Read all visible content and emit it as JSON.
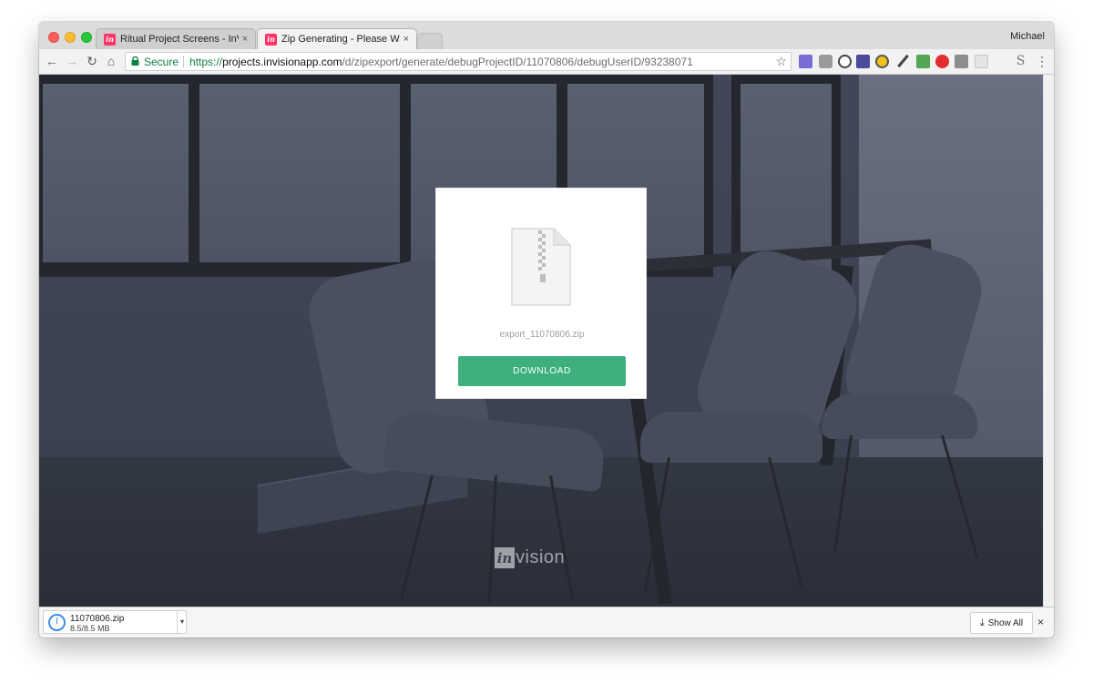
{
  "browser": {
    "profile_name": "Michael",
    "tabs": [
      {
        "title": "Ritual Project Screens - InVision",
        "close": "×",
        "active": false
      },
      {
        "title": "Zip Generating - Please Wait...",
        "close": "×",
        "active": true
      }
    ],
    "favicon_glyph": "in",
    "secure_label": "Secure",
    "url": {
      "scheme": "https://",
      "host": "projects.invisionapp.com",
      "path": "/d/zipexport/generate/debugProjectID/11070806/debugUserID/93238071"
    },
    "nav_icons": {
      "back": "←",
      "forward": "→",
      "reload": "↻",
      "home": "⌂",
      "star": "☆",
      "menu": "⋮"
    },
    "extension_icons": [
      "calendar-icon",
      "tools-icon",
      "onepassword-icon",
      "mail-icon",
      "chrome-icon",
      "pen-icon",
      "evernote-icon",
      "adblock-icon",
      "shield-icon",
      "reader-icon",
      "ghost-icon",
      "s-icon"
    ],
    "extension_12_glyph": "S"
  },
  "page": {
    "file_name": "export_11070806.zip",
    "download_button": "DOWNLOAD",
    "logo": {
      "badge": "in",
      "wordmark": "vision"
    }
  },
  "download_shelf": {
    "file_name": "11070806.zip",
    "progress": "8.5/8.5 MB",
    "progress_fraction": 1.0,
    "show_all": "Show All",
    "show_all_icon": "⤓",
    "dropdown_glyph": "▾",
    "close": "×"
  },
  "colors": {
    "accent_green": "#3db07e",
    "brand_pink": "#ff3366",
    "secure_green": "#0b8043"
  }
}
